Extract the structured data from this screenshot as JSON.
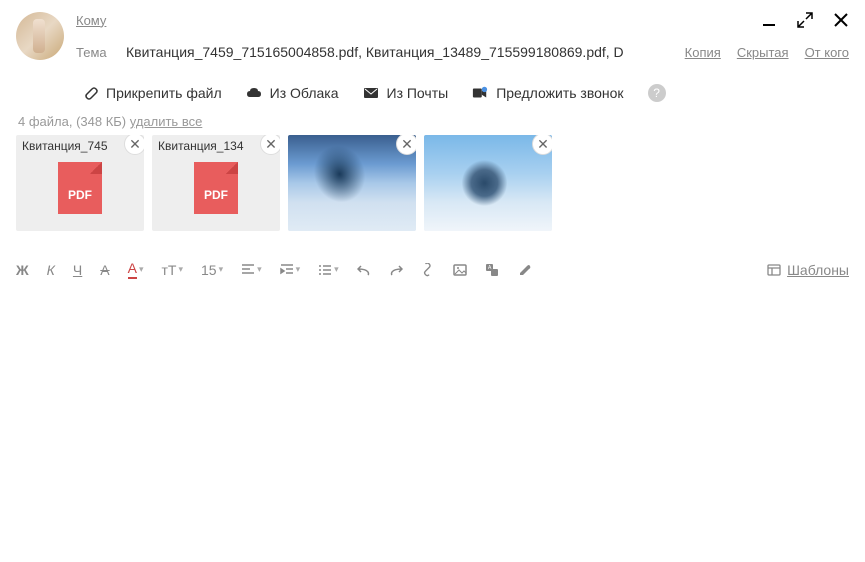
{
  "header": {
    "to_label": "Кому",
    "subject_label": "Тема",
    "subject_value": "Квитанция_7459_715165004858.pdf, Квитанция_13489_715599180869.pdf, D",
    "cc_label": "Копия",
    "bcc_label": "Скрытая",
    "from_label": "От кого"
  },
  "attach_bar": {
    "attach_file": "Прикрепить файл",
    "from_cloud": "Из Облака",
    "from_mail": "Из Почты",
    "suggest_call": "Предложить звонок"
  },
  "files": {
    "summary_prefix": "4 файла, (348 КБ) ",
    "delete_all": "удалить все",
    "items": [
      {
        "name": "Квитанция_745",
        "type": "pdf",
        "pdf_label": "PDF"
      },
      {
        "name": "Квитанция_134",
        "type": "pdf",
        "pdf_label": "PDF"
      },
      {
        "name": "",
        "type": "image1"
      },
      {
        "name": "",
        "type": "image2"
      }
    ]
  },
  "toolbar": {
    "bold": "Ж",
    "italic": "К",
    "underline": "Ч",
    "strike": "A",
    "color": "A",
    "fontsize_icon": "тT",
    "size": "15",
    "templates": "Шаблоны"
  }
}
